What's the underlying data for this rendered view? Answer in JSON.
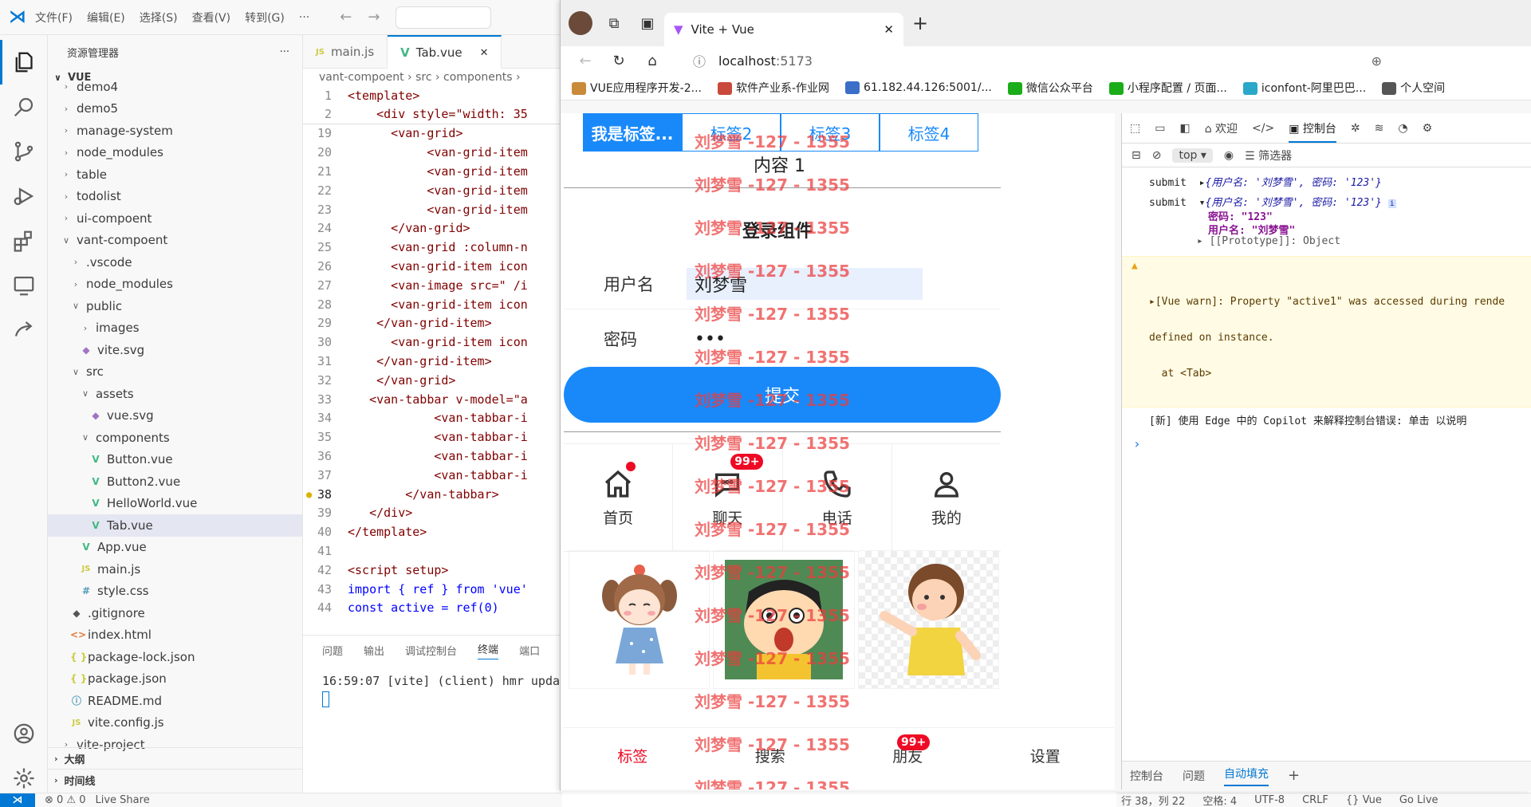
{
  "vscode": {
    "menus": [
      "文件(F)",
      "编辑(E)",
      "选择(S)",
      "查看(V)",
      "转到(G)",
      "···"
    ],
    "explorer_title": "资源管理器",
    "explorer_more": "···",
    "root": "VUE",
    "tree": [
      {
        "label": "demo4",
        "type": "folder",
        "indent": 1,
        "state": "closed"
      },
      {
        "label": "demo5",
        "type": "folder",
        "indent": 1,
        "state": "closed"
      },
      {
        "label": "manage-system",
        "type": "folder",
        "indent": 1,
        "state": "closed"
      },
      {
        "label": "node_modules",
        "type": "folder",
        "indent": 1,
        "state": "closed"
      },
      {
        "label": "table",
        "type": "folder",
        "indent": 1,
        "state": "closed"
      },
      {
        "label": "todolist",
        "type": "folder",
        "indent": 1,
        "state": "closed"
      },
      {
        "label": "ui-compoent",
        "type": "folder",
        "indent": 1,
        "state": "closed"
      },
      {
        "label": "vant-compoent",
        "type": "folder",
        "indent": 1,
        "state": "open"
      },
      {
        "label": ".vscode",
        "type": "folder",
        "indent": 2,
        "state": "closed"
      },
      {
        "label": "node_modules",
        "type": "folder",
        "indent": 2,
        "state": "closed"
      },
      {
        "label": "public",
        "type": "folder",
        "indent": 2,
        "state": "open"
      },
      {
        "label": "images",
        "type": "folder",
        "indent": 3,
        "state": "closed"
      },
      {
        "label": "vite.svg",
        "type": "svg",
        "indent": 3
      },
      {
        "label": "src",
        "type": "folder",
        "indent": 2,
        "state": "open"
      },
      {
        "label": "assets",
        "type": "folder",
        "indent": 3,
        "state": "open"
      },
      {
        "label": "vue.svg",
        "type": "svg",
        "indent": 4
      },
      {
        "label": "components",
        "type": "folder",
        "indent": 3,
        "state": "open"
      },
      {
        "label": "Button.vue",
        "type": "vue",
        "indent": 4
      },
      {
        "label": "Button2.vue",
        "type": "vue",
        "indent": 4
      },
      {
        "label": "HelloWorld.vue",
        "type": "vue",
        "indent": 4
      },
      {
        "label": "Tab.vue",
        "type": "vue",
        "indent": 4,
        "selected": true
      },
      {
        "label": "App.vue",
        "type": "vue",
        "indent": 3
      },
      {
        "label": "main.js",
        "type": "js",
        "indent": 3
      },
      {
        "label": "style.css",
        "type": "css",
        "indent": 3
      },
      {
        "label": ".gitignore",
        "type": "git",
        "indent": 2
      },
      {
        "label": "index.html",
        "type": "html",
        "indent": 2
      },
      {
        "label": "package-lock.json",
        "type": "json",
        "indent": 2
      },
      {
        "label": "package.json",
        "type": "json",
        "indent": 2
      },
      {
        "label": "README.md",
        "type": "md",
        "indent": 2
      },
      {
        "label": "vite.config.js",
        "type": "js",
        "indent": 2
      },
      {
        "label": "vite-project",
        "type": "folder",
        "indent": 1,
        "state": "closed"
      }
    ],
    "outline": "大纲",
    "timeline": "时间线",
    "tabs": [
      {
        "label": "main.js",
        "icon": "JS"
      },
      {
        "label": "Tab.vue",
        "icon": "V",
        "close": "✕"
      }
    ],
    "breadcrumb": "vant-compoent › src › components ›",
    "code": [
      {
        "n": "1",
        "t": "<template>"
      },
      {
        "n": "2",
        "t": "    <div style=\"width: 35"
      },
      {
        "n": "19",
        "t": "      <van-grid>"
      },
      {
        "n": "20",
        "t": "           <van-grid-item"
      },
      {
        "n": "21",
        "t": "           <van-grid-item"
      },
      {
        "n": "22",
        "t": "           <van-grid-item"
      },
      {
        "n": "23",
        "t": "           <van-grid-item"
      },
      {
        "n": "24",
        "t": "      </van-grid>"
      },
      {
        "n": "25",
        "t": "      <van-grid :column-n"
      },
      {
        "n": "26",
        "t": "      <van-grid-item icon"
      },
      {
        "n": "27",
        "t": "      <van-image src=\" /i"
      },
      {
        "n": "28",
        "t": "      <van-grid-item icon"
      },
      {
        "n": "29",
        "t": "    </van-grid-item>"
      },
      {
        "n": "30",
        "t": "      <van-grid-item icon"
      },
      {
        "n": "31",
        "t": "    </van-grid-item>"
      },
      {
        "n": "32",
        "t": "    </van-grid>"
      },
      {
        "n": "33",
        "t": "   <van-tabbar v-model=\"a"
      },
      {
        "n": "34",
        "t": "            <van-tabbar-i"
      },
      {
        "n": "35",
        "t": "            <van-tabbar-i"
      },
      {
        "n": "36",
        "t": "            <van-tabbar-i"
      },
      {
        "n": "37",
        "t": "            <van-tabbar-i"
      },
      {
        "n": "38",
        "t": "        </van-tabbar>",
        "current": true
      },
      {
        "n": "39",
        "t": "   </div>"
      },
      {
        "n": "40",
        "t": "</template>"
      },
      {
        "n": "41",
        "t": ""
      },
      {
        "n": "42",
        "t": "<script setup>"
      },
      {
        "n": "43",
        "t": "import { ref } from 'vue'"
      },
      {
        "n": "44",
        "t": "const active = ref(0)"
      }
    ],
    "panel_tabs": [
      "问题",
      "输出",
      "调试控制台",
      "终端",
      "端口"
    ],
    "terminal_line": "16:59:07 [vite] (client) hmr upda",
    "status_left": [
      "⊗ 0 ⚠ 0",
      "Live Share"
    ],
    "status_right": [
      "行 38，列 22",
      "空格: 4",
      "UTF-8",
      "CRLF",
      "{} Vue",
      "Go Live"
    ]
  },
  "browser": {
    "tab_title": "Vite + Vue",
    "tab_close": "✕",
    "new_tab": "+",
    "address_host": "localhost",
    "address_port": ":5173",
    "favorites": [
      "VUE应用程序开发-2...",
      "软件产业系-作业网",
      "61.182.44.126:5001/...",
      "微信公众平台",
      "小程序配置 / 页面...",
      "iconfont-阿里巴巴...",
      "个人空间"
    ],
    "favorite_colors": [
      "#c98a3a",
      "#c94a3a",
      "#3a6ec9",
      "#1aad19",
      "#1aad19",
      "#2aa8c9",
      "#555555"
    ]
  },
  "vant": {
    "tabs": [
      "我是标签...",
      "标签2",
      "标签3",
      "标签4"
    ],
    "tab_content": "内容 1",
    "form_title": "登录组件",
    "username_label": "用户名",
    "username_value": "刘梦雪",
    "password_label": "密码",
    "password_value": "•••",
    "submit_label": "提交",
    "grid": [
      {
        "label": "首页",
        "icon": "home-icon",
        "dot": true
      },
      {
        "label": "聊天",
        "icon": "chat-icon",
        "badge": "99+"
      },
      {
        "label": "电话",
        "icon": "phone-icon"
      },
      {
        "label": "我的",
        "icon": "user-icon"
      }
    ],
    "tabbar": [
      {
        "label": "标签",
        "active": true
      },
      {
        "label": "搜索"
      },
      {
        "label": "朋友",
        "badge": "99+"
      },
      {
        "label": "设置"
      }
    ],
    "watermark": "刘梦雪 -127 - 1355"
  },
  "devtools": {
    "tabs": [
      "欢迎",
      "控制台"
    ],
    "context": "top",
    "filter": "筛选器",
    "logs": [
      {
        "label": "submit",
        "obj": "{用户名: '刘梦雪', 密码: '123'}"
      },
      {
        "label": "submit",
        "obj": "{用户名: '刘梦雪', 密码: '123'}"
      }
    ],
    "expanded": [
      "密码: \"123\"",
      "用户名: \"刘梦雪\"",
      "[[Prototype]]: Object"
    ],
    "warn_lines": [
      "[Vue warn]: Property \"active1\" was accessed during rende",
      "defined on instance.",
      "  at <Tab>"
    ],
    "info": "[新] 使用 Edge 中的 Copilot 来解释控制台错误: 单击  以说明",
    "prompt": "›",
    "bottom_tabs": [
      "控制台",
      "问题",
      "自动填充"
    ],
    "bottom_add": "+"
  }
}
